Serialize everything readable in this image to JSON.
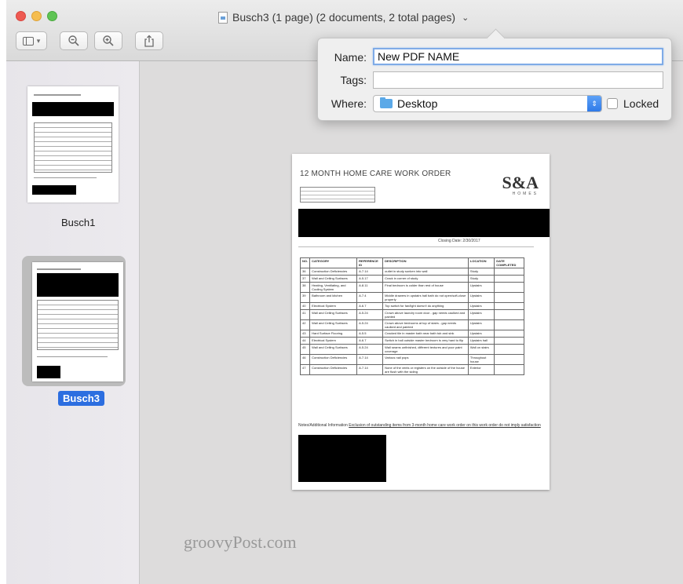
{
  "window": {
    "title": "Busch3 (1 page) (2 documents, 2 total pages)",
    "title_chevron": "⌄"
  },
  "toolbar": {
    "sidebar_icon": "sidebar-icon",
    "zoom_out_icon": "zoom-out-icon",
    "zoom_in_icon": "zoom-in-icon",
    "share_icon": "share-icon"
  },
  "sidebar": {
    "items": [
      {
        "label": "Busch1",
        "selected": false
      },
      {
        "label": "Busch3",
        "selected": true
      }
    ]
  },
  "save_popover": {
    "name_label": "Name:",
    "name_value": "New PDF NAME",
    "tags_label": "Tags:",
    "tags_value": "",
    "where_label": "Where:",
    "where_value": "Desktop",
    "locked_label": "Locked",
    "locked_checked": false
  },
  "document": {
    "title": "12 MONTH HOME CARE WORK ORDER",
    "logo": "S&A",
    "logo_sub": "HOMES",
    "closing_date": "Closing Date: 2/30/2017",
    "table_headers": [
      "NO.",
      "CATEGORY",
      "REFERENCE ID",
      "DESCRIPTION",
      "LOCATION",
      "DATE COMPLETED"
    ],
    "table_rows": [
      [
        "36",
        "Construction Deficiencies",
        "A.7.14",
        "outlet in study sunken into wall",
        "Study",
        ""
      ],
      [
        "37",
        "Wall and Ceiling Surfaces",
        "A.5.17",
        "Crack in corner of study",
        "Study",
        ""
      ],
      [
        "38",
        "Heating, Ventilating, and Cooling System",
        "A.8.11",
        "Final bedroom is colder than rest of house",
        "Upstairs",
        ""
      ],
      [
        "39",
        "Bathroom and kitchen",
        "A.7.4",
        "Middle drawers in upstairs hall bath do not open/soft-close properly",
        "Upstairs",
        ""
      ],
      [
        "40",
        "Electrical System",
        "A.6.7",
        "Top switch for fan/light doesn't do anything",
        "Upstairs",
        ""
      ],
      [
        "41",
        "Wall and Ceiling Surfaces",
        "A.5.24",
        "Crown above laundry room door - gap needs caulked and painted",
        "Upstairs",
        ""
      ],
      [
        "42",
        "Wall and Ceiling Surfaces",
        "A.5.24",
        "Crown above bedrooms at top of stairs - gap needs caulked and painted",
        "Upstairs",
        ""
      ],
      [
        "43",
        "Hard Surface Flooring",
        "A.5.5",
        "Cracked tile in master bath near bath tub and sink",
        "Upstairs",
        ""
      ],
      [
        "44",
        "Electrical System",
        "A.6.7",
        "Switch in hall outside master bedroom is very hard to flip",
        "Upstairs hall",
        ""
      ],
      [
        "45",
        "Wall and Ceiling Surfaces",
        "A.5.24",
        "Wall seams unfinished, different textures and poor paint coverage",
        "Wall on stairs",
        ""
      ],
      [
        "46",
        "Construction Deficiencies",
        "A.7.14",
        "Various nail pops",
        "Throughout house",
        ""
      ],
      [
        "47",
        "Construction Deficiencies",
        "A.7.14",
        "None of the vents or registers on the outside of the house are flush with the siding",
        "Exterior",
        ""
      ]
    ],
    "notes_label": "Notes/Additional Information",
    "notes_text": "Exclusion of outstanding items from 3-month home care work order on this work order do not imply satisfaction or completion."
  },
  "watermark": "groovyPost.com"
}
